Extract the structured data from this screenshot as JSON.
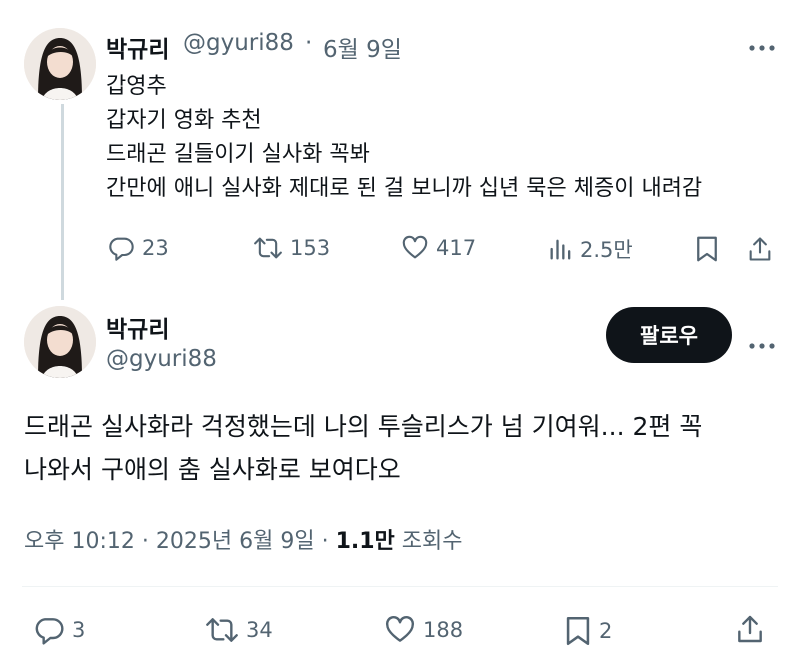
{
  "first_tweet": {
    "author_name": "박규리",
    "handle": "@gyuri88",
    "separator": "·",
    "date": "6월 9일",
    "lines": [
      "갑영추",
      "갑자기 영화 추천",
      "드래곤 길들이기 실사화 꼭봐",
      "간만에 애니 실사화 제대로 된 걸 보니까 십년 묵은 체증이 내려감"
    ],
    "actions": {
      "reply_count": "23",
      "retweet_count": "153",
      "like_count": "417",
      "view_count": "2.5만"
    }
  },
  "main_tweet": {
    "author_name": "박규리",
    "handle": "@gyuri88",
    "follow_label": "팔로우",
    "lines": [
      "드래곤 실사화라 걱정했는데 나의 투슬리스가 넘 기여워... 2편 꼭",
      "나와서 구애의 춤 실사화로 보여다오"
    ],
    "time": "오후 10:12",
    "separator": "·",
    "date": "2025년 6월 9일",
    "separator2": "·",
    "views_count": "1.1만",
    "views_label": "조회수",
    "actions": {
      "reply_count": "3",
      "retweet_count": "34",
      "like_count": "188",
      "bookmark_count": "2"
    }
  },
  "icons": [
    "reply-icon",
    "retweet-icon",
    "like-icon",
    "views-icon",
    "bookmark-icon",
    "share-icon",
    "more-icon"
  ],
  "colors": {
    "text": "#0f1419",
    "secondary": "#536471",
    "thread_line": "#cfd9de",
    "follow_bg": "#0f1419"
  }
}
